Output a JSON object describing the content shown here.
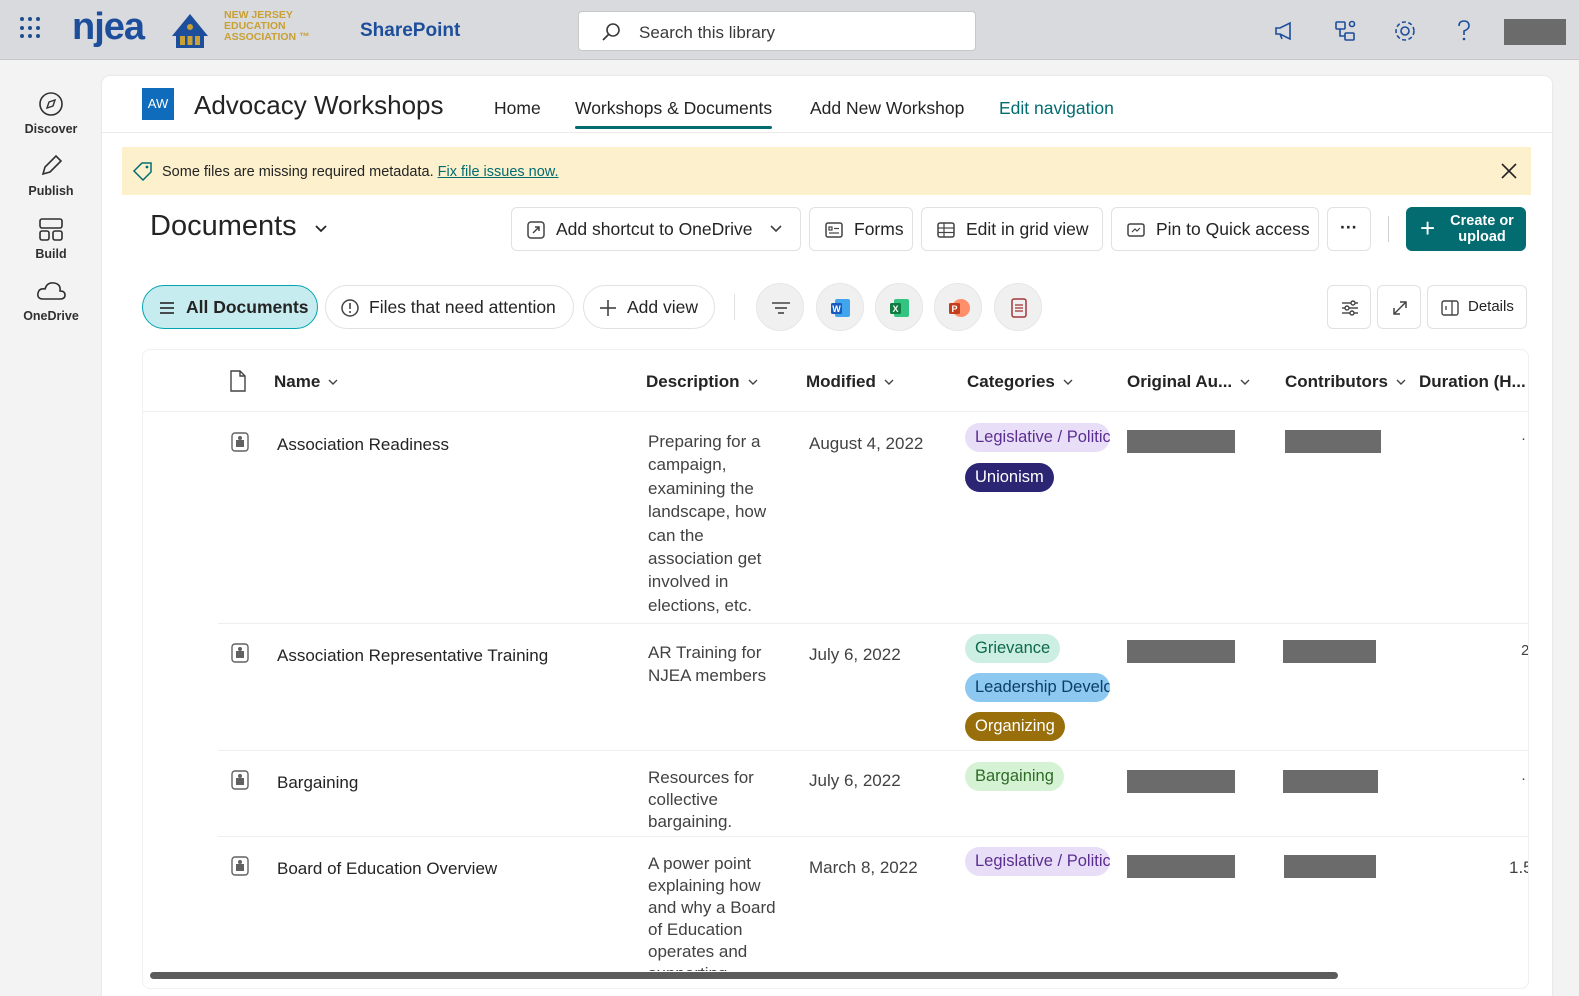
{
  "suite": {
    "org_wordmark": "njea",
    "org_sub": [
      "NEW JERSEY",
      "EDUCATION",
      "ASSOCIATION ™"
    ],
    "app_name": "SharePoint",
    "search_placeholder": "Search this library",
    "icons": [
      "app-launcher-icon",
      "megaphone-icon",
      "share-icon",
      "gear-icon",
      "help-icon"
    ]
  },
  "rail": [
    {
      "label": "Discover",
      "icon": "compass-icon"
    },
    {
      "label": "Publish",
      "icon": "pencil-icon"
    },
    {
      "label": "Build",
      "icon": "layout-icon"
    },
    {
      "label": "OneDrive",
      "icon": "cloud-icon"
    }
  ],
  "site": {
    "logo_initials": "AW",
    "title": "Advocacy Workshops",
    "nav": [
      {
        "label": "Home",
        "active": false
      },
      {
        "label": "Workshops & Documents",
        "active": true
      },
      {
        "label": "Add New Workshop",
        "active": false
      },
      {
        "label": "Edit navigation",
        "active": false
      }
    ]
  },
  "banner": {
    "message": "Some files are missing required metadata.",
    "link": "Fix file issues now."
  },
  "library": {
    "title": "Documents",
    "commands": [
      {
        "label": "Add shortcut to OneDrive",
        "icon": "shortcut-icon"
      },
      {
        "label": "Forms",
        "icon": "forms-icon"
      },
      {
        "label": "Edit in grid view",
        "icon": "grid-icon"
      },
      {
        "label": "Pin to Quick access",
        "icon": "pin-icon"
      },
      {
        "label": "···",
        "icon": "more-icon"
      }
    ],
    "create_label": "Create or upload",
    "views": [
      {
        "label": "All Documents",
        "active": true
      },
      {
        "label": "Files that need attention",
        "active": false
      },
      {
        "label": "Add view",
        "active": false
      }
    ],
    "details_label": "Details"
  },
  "table": {
    "columns": [
      "Name",
      "Description",
      "Modified",
      "Categories",
      "Original Au...",
      "Contributors",
      "Duration (H..."
    ],
    "rows": [
      {
        "name": "Association Readiness",
        "description": "Preparing for a campaign, examining the landscape, how can the association get involved in elections, etc.",
        "modified": "August 4, 2022",
        "categories": [
          {
            "label": "Legislative / Politic",
            "bg": "#e8def8",
            "fg": "#5c2e91"
          },
          {
            "label": "Unionism",
            "bg": "#2b2574",
            "fg": "#ffffff"
          }
        ],
        "duration": "·"
      },
      {
        "name": "Association Representative Training",
        "description": "AR Training for NJEA members",
        "modified": "July 6, 2022",
        "categories": [
          {
            "label": "Grievance",
            "bg": "#cdeee3",
            "fg": "#0b6a4a"
          },
          {
            "label": "Leadership Develo",
            "bg": "#8cc8f0",
            "fg": "#0b3e66"
          },
          {
            "label": "Organizing",
            "bg": "#986f0b",
            "fg": "#ffffff"
          }
        ],
        "duration": "2"
      },
      {
        "name": "Bargaining",
        "description": "Resources for collective bargaining.",
        "modified": "July 6, 2022",
        "categories": [
          {
            "label": "Bargaining",
            "bg": "#d6f2d4",
            "fg": "#2e6b27"
          }
        ],
        "duration": "·"
      },
      {
        "name": "Board of Education Overview",
        "description": "A power point explaining how and why a Board of Education operates and supporting",
        "modified": "March 8, 2022",
        "categories": [
          {
            "label": "Legislative / Politic",
            "bg": "#e8def8",
            "fg": "#5c2e91"
          }
        ],
        "duration": "1.5"
      }
    ]
  },
  "colors": {
    "accent": "#036c70",
    "banner_bg": "#fcf0cd",
    "brand_blue": "#1d4e9b"
  }
}
